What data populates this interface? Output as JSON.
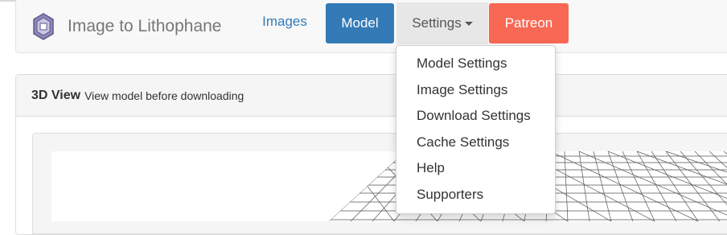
{
  "brand": {
    "name": "Image to Lithophane",
    "logo_icon": "hexagon-logo-icon"
  },
  "nav": {
    "images": "Images",
    "model": "Model",
    "settings": "Settings",
    "patreon": "Patreon"
  },
  "colors": {
    "primary": "#337ab7",
    "patreon": "#f96854"
  },
  "panel": {
    "title": "3D View",
    "subtitle": "View model before downloading"
  },
  "dropdown": {
    "items": [
      "Model Settings",
      "Image Settings",
      "Download Settings",
      "Cache Settings",
      "Help",
      "Supporters"
    ]
  }
}
